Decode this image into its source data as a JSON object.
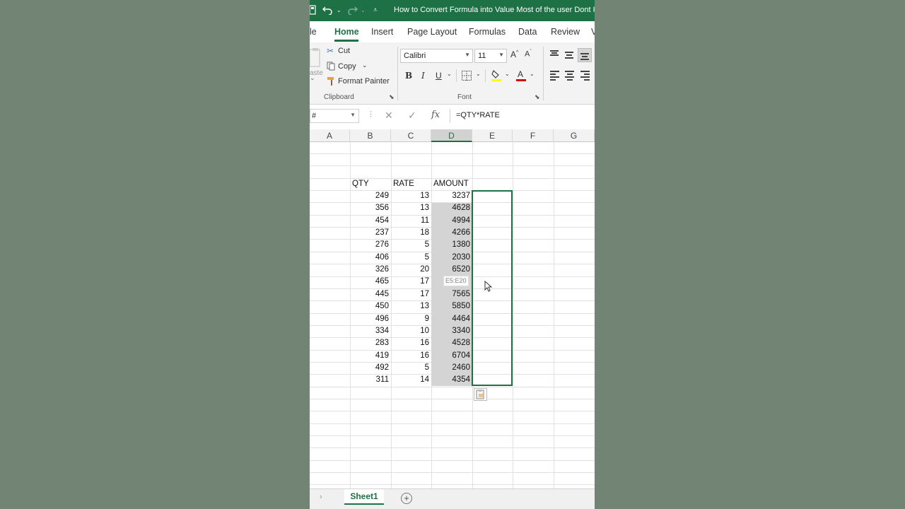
{
  "window": {
    "title": "How to Convert Formula into Value Most of the user Dont Kn"
  },
  "tabs": [
    {
      "label": "le"
    },
    {
      "label": "Home"
    },
    {
      "label": "Insert"
    },
    {
      "label": "Page Layout"
    },
    {
      "label": "Formulas"
    },
    {
      "label": "Data"
    },
    {
      "label": "Review"
    },
    {
      "label": "V"
    }
  ],
  "clipboard": {
    "paste_label": "aste",
    "cut_label": "Cut",
    "copy_label": "Copy",
    "format_painter_label": "Format Painter",
    "group_label": "Clipboard"
  },
  "font": {
    "font_name": "Calibri",
    "font_size": "11",
    "bold": "B",
    "italic": "I",
    "underline": "U",
    "group_label": "Font",
    "fill_color": "#ffff00",
    "font_color": "#e00000"
  },
  "formula_bar": {
    "name_box": "#",
    "formula": "=QTY*RATE"
  },
  "columns": [
    "A",
    "B",
    "C",
    "D",
    "E",
    "F",
    "G"
  ],
  "selected_column": "D",
  "headers": {
    "qty": "QTY",
    "rate": "RATE",
    "amount": "AMOUNT"
  },
  "rows": [
    {
      "qty": "249",
      "rate": "13",
      "amount": "3237"
    },
    {
      "qty": "356",
      "rate": "13",
      "amount": "4628"
    },
    {
      "qty": "454",
      "rate": "11",
      "amount": "4994"
    },
    {
      "qty": "237",
      "rate": "18",
      "amount": "4266"
    },
    {
      "qty": "276",
      "rate": "5",
      "amount": "1380"
    },
    {
      "qty": "406",
      "rate": "5",
      "amount": "2030"
    },
    {
      "qty": "326",
      "rate": "20",
      "amount": "6520"
    },
    {
      "qty": "465",
      "rate": "17",
      "amount": ""
    },
    {
      "qty": "445",
      "rate": "17",
      "amount": "7565"
    },
    {
      "qty": "450",
      "rate": "13",
      "amount": "5850"
    },
    {
      "qty": "496",
      "rate": "9",
      "amount": "4464"
    },
    {
      "qty": "334",
      "rate": "10",
      "amount": "3340"
    },
    {
      "qty": "283",
      "rate": "16",
      "amount": "4528"
    },
    {
      "qty": "419",
      "rate": "16",
      "amount": "6704"
    },
    {
      "qty": "492",
      "rate": "5",
      "amount": "2460"
    },
    {
      "qty": "311",
      "rate": "14",
      "amount": "4354"
    }
  ],
  "drag_tooltip": "E5:E20",
  "sheets": [
    {
      "label": "Sheet1"
    }
  ],
  "accent_color": "#1e7145"
}
